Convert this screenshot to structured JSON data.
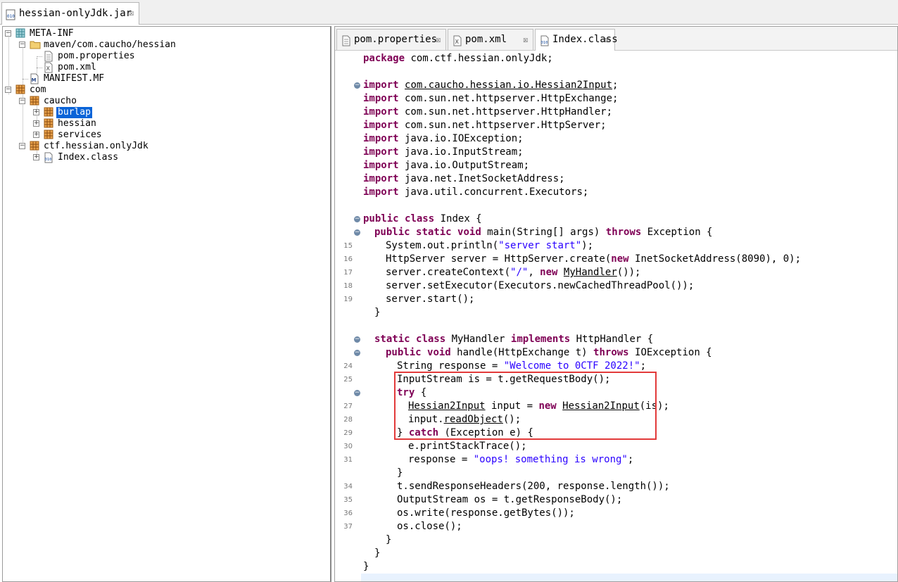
{
  "window": {
    "main_tab_title": "hessian-onlyJdk.jar",
    "close_glyph": "☒"
  },
  "tree": {
    "items": [
      {
        "label": "META-INF",
        "icon": "package-folder-icon"
      },
      {
        "label": "maven/com.caucho/hessian",
        "icon": "folder-icon"
      },
      {
        "label": "pom.properties",
        "icon": "text-file-icon"
      },
      {
        "label": "pom.xml",
        "icon": "xml-file-icon"
      },
      {
        "label": "MANIFEST.MF",
        "icon": "manifest-file-icon"
      },
      {
        "label": "com",
        "icon": "package-icon"
      },
      {
        "label": "caucho",
        "icon": "package-icon"
      },
      {
        "label": "burlap",
        "icon": "package-icon",
        "selected": true
      },
      {
        "label": "hessian",
        "icon": "package-icon"
      },
      {
        "label": "services",
        "icon": "package-icon"
      },
      {
        "label": "ctf.hessian.onlyJdk",
        "icon": "package-icon"
      },
      {
        "label": "Index.class",
        "icon": "class-file-icon"
      }
    ]
  },
  "editor": {
    "tabs": [
      {
        "label": "pom.properties",
        "icon": "text-file-icon",
        "active": false
      },
      {
        "label": "pom.xml",
        "icon": "xml-file-icon",
        "active": false
      },
      {
        "label": "Index.class",
        "icon": "class-file-icon",
        "active": true
      }
    ],
    "code_lines": [
      {
        "indent": 0,
        "num": "",
        "fold": false,
        "tokens": [
          {
            "t": "package",
            "c": "kw"
          },
          {
            "t": " com.ctf.hessian.onlyJdk;"
          }
        ]
      },
      {
        "indent": 0,
        "num": "",
        "fold": false,
        "tokens": []
      },
      {
        "indent": 0,
        "num": "",
        "fold": true,
        "tokens": [
          {
            "t": "import",
            "c": "kw"
          },
          {
            "t": " "
          },
          {
            "t": "com.caucho.hessian.io.Hessian2Input",
            "c": "ul"
          },
          {
            "t": ";"
          }
        ]
      },
      {
        "indent": 0,
        "num": "",
        "fold": false,
        "tokens": [
          {
            "t": "import",
            "c": "kw"
          },
          {
            "t": " com.sun.net.httpserver.HttpExchange;"
          }
        ]
      },
      {
        "indent": 0,
        "num": "",
        "fold": false,
        "tokens": [
          {
            "t": "import",
            "c": "kw"
          },
          {
            "t": " com.sun.net.httpserver.HttpHandler;"
          }
        ]
      },
      {
        "indent": 0,
        "num": "",
        "fold": false,
        "tokens": [
          {
            "t": "import",
            "c": "kw"
          },
          {
            "t": " com.sun.net.httpserver.HttpServer;"
          }
        ]
      },
      {
        "indent": 0,
        "num": "",
        "fold": false,
        "tokens": [
          {
            "t": "import",
            "c": "kw"
          },
          {
            "t": " java.io.IOException;"
          }
        ]
      },
      {
        "indent": 0,
        "num": "",
        "fold": false,
        "tokens": [
          {
            "t": "import",
            "c": "kw"
          },
          {
            "t": " java.io.InputStream;"
          }
        ]
      },
      {
        "indent": 0,
        "num": "",
        "fold": false,
        "tokens": [
          {
            "t": "import",
            "c": "kw"
          },
          {
            "t": " java.io.OutputStream;"
          }
        ]
      },
      {
        "indent": 0,
        "num": "",
        "fold": false,
        "tokens": [
          {
            "t": "import",
            "c": "kw"
          },
          {
            "t": " java.net.InetSocketAddress;"
          }
        ]
      },
      {
        "indent": 0,
        "num": "",
        "fold": false,
        "tokens": [
          {
            "t": "import",
            "c": "kw"
          },
          {
            "t": " java.util.concurrent.Executors;"
          }
        ]
      },
      {
        "indent": 0,
        "num": "",
        "fold": false,
        "tokens": []
      },
      {
        "indent": 0,
        "num": "",
        "fold": true,
        "tokens": [
          {
            "t": "public",
            "c": "kw"
          },
          {
            "t": " "
          },
          {
            "t": "class",
            "c": "kw"
          },
          {
            "t": " Index {"
          }
        ]
      },
      {
        "indent": 1,
        "num": "",
        "fold": true,
        "tokens": [
          {
            "t": "public",
            "c": "kw"
          },
          {
            "t": " "
          },
          {
            "t": "static",
            "c": "kw"
          },
          {
            "t": " "
          },
          {
            "t": "void",
            "c": "kw"
          },
          {
            "t": " main(String[] args) "
          },
          {
            "t": "throws",
            "c": "kw"
          },
          {
            "t": " Exception {"
          }
        ]
      },
      {
        "indent": 2,
        "num": "15",
        "fold": false,
        "tokens": [
          {
            "t": "System.out.println("
          },
          {
            "t": "\"server start\"",
            "c": "str"
          },
          {
            "t": ");"
          }
        ]
      },
      {
        "indent": 2,
        "num": "16",
        "fold": false,
        "tokens": [
          {
            "t": "HttpServer server = HttpServer.create("
          },
          {
            "t": "new",
            "c": "kw"
          },
          {
            "t": " InetSocketAddress(8090), 0);"
          }
        ]
      },
      {
        "indent": 2,
        "num": "17",
        "fold": false,
        "tokens": [
          {
            "t": "server.createContext("
          },
          {
            "t": "\"/\"",
            "c": "str"
          },
          {
            "t": ", "
          },
          {
            "t": "new",
            "c": "kw"
          },
          {
            "t": " "
          },
          {
            "t": "MyHandler",
            "c": "ul"
          },
          {
            "t": "());"
          }
        ]
      },
      {
        "indent": 2,
        "num": "18",
        "fold": false,
        "tokens": [
          {
            "t": "server.setExecutor(Executors.newCachedThreadPool());"
          }
        ]
      },
      {
        "indent": 2,
        "num": "19",
        "fold": false,
        "tokens": [
          {
            "t": "server.start();"
          }
        ]
      },
      {
        "indent": 1,
        "num": "",
        "fold": false,
        "tokens": [
          {
            "t": "}"
          }
        ]
      },
      {
        "indent": 0,
        "num": "",
        "fold": false,
        "tokens": []
      },
      {
        "indent": 1,
        "num": "",
        "fold": true,
        "tokens": [
          {
            "t": "static",
            "c": "kw"
          },
          {
            "t": " "
          },
          {
            "t": "class",
            "c": "kw"
          },
          {
            "t": " MyHandler "
          },
          {
            "t": "implements",
            "c": "kw"
          },
          {
            "t": " HttpHandler {"
          }
        ]
      },
      {
        "indent": 2,
        "num": "",
        "fold": true,
        "tokens": [
          {
            "t": "public",
            "c": "kw"
          },
          {
            "t": " "
          },
          {
            "t": "void",
            "c": "kw"
          },
          {
            "t": " handle(HttpExchange t) "
          },
          {
            "t": "throws",
            "c": "kw"
          },
          {
            "t": " IOException {"
          }
        ]
      },
      {
        "indent": 3,
        "num": "24",
        "fold": false,
        "tokens": [
          {
            "t": "String response = "
          },
          {
            "t": "\"Welcome to 0CTF 2022!\"",
            "c": "str"
          },
          {
            "t": ";"
          }
        ]
      },
      {
        "indent": 3,
        "num": "25",
        "fold": false,
        "tokens": [
          {
            "t": "InputStream is = t.getRequestBody();"
          }
        ]
      },
      {
        "indent": 3,
        "num": "",
        "fold": true,
        "tokens": [
          {
            "t": "try",
            "c": "kw"
          },
          {
            "t": " {"
          }
        ]
      },
      {
        "indent": 4,
        "num": "27",
        "fold": false,
        "tokens": [
          {
            "t": "Hessian2Input",
            "c": "ul"
          },
          {
            "t": " input = "
          },
          {
            "t": "new",
            "c": "kw"
          },
          {
            "t": " "
          },
          {
            "t": "Hessian2Input",
            "c": "ul"
          },
          {
            "t": "(is);"
          }
        ]
      },
      {
        "indent": 4,
        "num": "28",
        "fold": false,
        "tokens": [
          {
            "t": "input."
          },
          {
            "t": "readObject",
            "c": "ul"
          },
          {
            "t": "();"
          }
        ]
      },
      {
        "indent": 3,
        "num": "29",
        "fold": false,
        "tokens": [
          {
            "t": "} "
          },
          {
            "t": "catch",
            "c": "kw"
          },
          {
            "t": " (Exception e) {"
          }
        ]
      },
      {
        "indent": 4,
        "num": "30",
        "fold": false,
        "tokens": [
          {
            "t": "e.printStackTrace();"
          }
        ]
      },
      {
        "indent": 4,
        "num": "31",
        "fold": false,
        "tokens": [
          {
            "t": "response = "
          },
          {
            "t": "\"oops! something is wrong\"",
            "c": "str"
          },
          {
            "t": ";"
          }
        ]
      },
      {
        "indent": 3,
        "num": "",
        "fold": false,
        "tokens": [
          {
            "t": "}"
          }
        ]
      },
      {
        "indent": 3,
        "num": "34",
        "fold": false,
        "tokens": [
          {
            "t": "t.sendResponseHeaders(200, response.length());"
          }
        ]
      },
      {
        "indent": 3,
        "num": "35",
        "fold": false,
        "tokens": [
          {
            "t": "OutputStream os = t.getResponseBody();"
          }
        ]
      },
      {
        "indent": 3,
        "num": "36",
        "fold": false,
        "tokens": [
          {
            "t": "os.write(response.getBytes());"
          }
        ]
      },
      {
        "indent": 3,
        "num": "37",
        "fold": false,
        "tokens": [
          {
            "t": "os.close();"
          }
        ]
      },
      {
        "indent": 2,
        "num": "",
        "fold": false,
        "tokens": [
          {
            "t": "}"
          }
        ]
      },
      {
        "indent": 1,
        "num": "",
        "fold": false,
        "tokens": [
          {
            "t": "}"
          }
        ]
      },
      {
        "indent": 0,
        "num": "",
        "fold": false,
        "tokens": [
          {
            "t": "}"
          }
        ]
      }
    ]
  },
  "colors": {
    "keyword": "#7f0055",
    "string": "#2a00ff",
    "selection": "#0a64d8",
    "highlight_box": "#e23a3a"
  }
}
